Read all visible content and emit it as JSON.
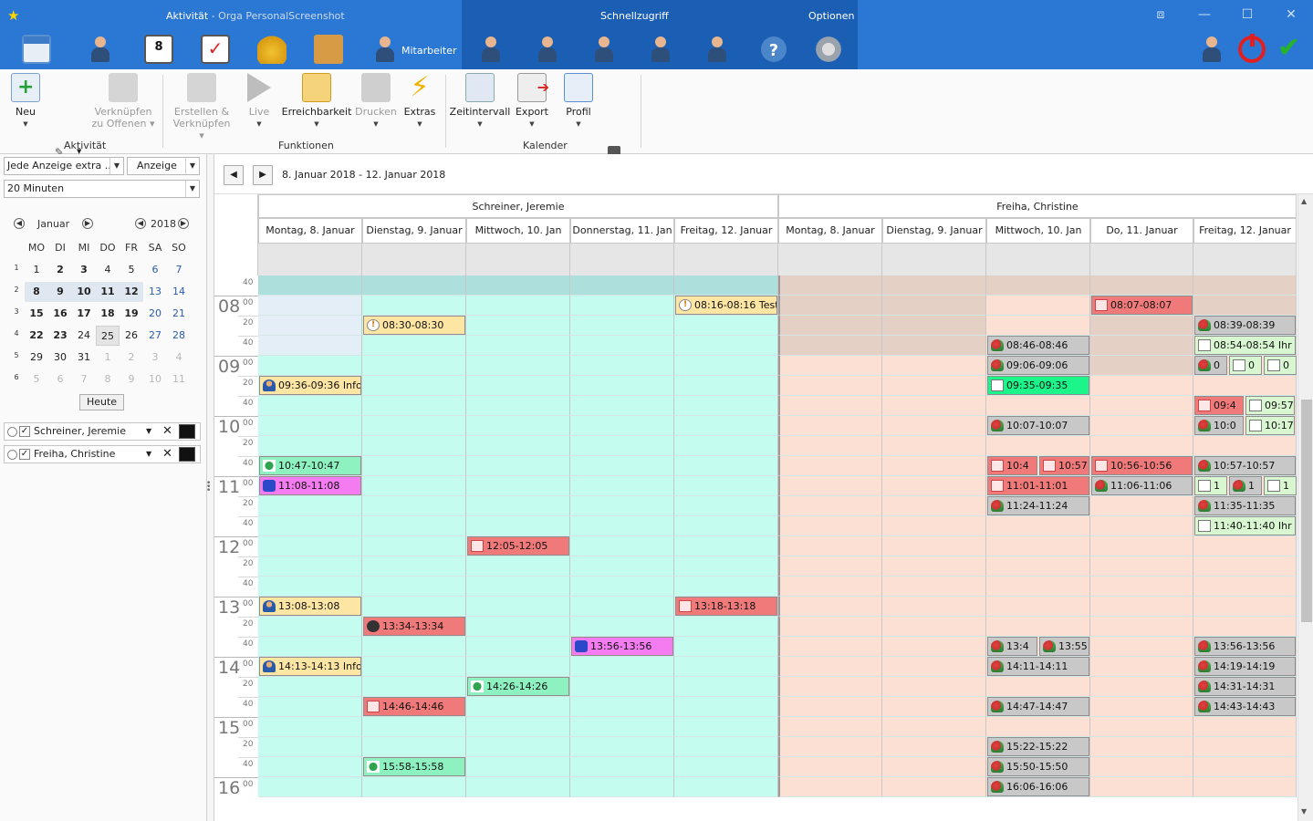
{
  "window": {
    "title_active": "Aktivität",
    "title_app": "Orga PersonalScreenshot",
    "quick_access": "Schnellzugriff",
    "options": "Optionen"
  },
  "toolbar": {
    "mitarbeiter_label": "Mitarbeiter"
  },
  "ribbon": {
    "groups": {
      "aktivitaet": "Aktivität",
      "funktionen": "Funktionen",
      "kalender": "Kalender"
    },
    "buttons": {
      "neu": "Neu",
      "verknuepfen_1": "Verknüpfen",
      "verknuepfen_2": "zu Offenen",
      "erstellen_1": "Erstellen &",
      "erstellen_2": "Verknüpfen",
      "live": "Live",
      "erreichbarkeit": "Erreichbarkeit",
      "drucken": "Drucken",
      "extras": "Extras",
      "zeitintervall": "Zeitintervall",
      "export": "Export",
      "profil": "Profil"
    }
  },
  "left": {
    "view_combo": "Jede Anzeige extra ...",
    "anzeige_combo": "Anzeige",
    "interval_combo": "20 Minuten",
    "month": "Januar",
    "year": "2018",
    "dow": [
      "MO",
      "DI",
      "MI",
      "DO",
      "FR",
      "SA",
      "SO"
    ],
    "weeks": [
      "1",
      "2",
      "3",
      "4",
      "5",
      "6"
    ],
    "days": [
      [
        "1",
        "2",
        "3",
        "4",
        "5",
        "6",
        "7"
      ],
      [
        "8",
        "9",
        "10",
        "11",
        "12",
        "13",
        "14"
      ],
      [
        "15",
        "16",
        "17",
        "18",
        "19",
        "20",
        "21"
      ],
      [
        "22",
        "23",
        "24",
        "25",
        "26",
        "27",
        "28"
      ],
      [
        "29",
        "30",
        "31",
        "1",
        "2",
        "3",
        "4"
      ],
      [
        "5",
        "6",
        "7",
        "8",
        "9",
        "10",
        "11"
      ]
    ],
    "today_button": "Heute",
    "resources": [
      "Schreiner, Jeremie",
      "Freiha, Christine"
    ]
  },
  "scheduler": {
    "date_range": "8. Januar 2018 - 12. Januar 2018",
    "resources": [
      "Schreiner, Jeremie",
      "Freiha, Christine"
    ],
    "days_jeremie": [
      "Montag, 8. Januar",
      "Dienstag, 9. Januar",
      "Mittwoch, 10. Jan",
      "Donnerstag, 11. Jan",
      "Freitag, 12. Januar"
    ],
    "days_christine": [
      "Montag, 8. Januar",
      "Dienstag, 9. Januar",
      "Mittwoch, 10. Jan",
      "Do, 11. Januar",
      "Freitag, 12. Januar"
    ],
    "hours": [
      "08",
      "09",
      "10",
      "11",
      "12",
      "13",
      "14",
      "15",
      "16"
    ],
    "minute_labels": [
      "00",
      "20",
      "40"
    ],
    "top_minute": "40"
  },
  "events": [
    {
      "col": 4,
      "slot": 1,
      "text": "08:16-08:16 Test",
      "kind": "yellow",
      "icon": "warn"
    },
    {
      "col": 1,
      "slot": 2,
      "text": "08:30-08:30",
      "kind": "yellow",
      "icon": "warn"
    },
    {
      "col": 0,
      "slot": 5,
      "text": "09:36-09:36 Info",
      "kind": "yellow",
      "icon": "user"
    },
    {
      "col": 0,
      "slot": 9,
      "text": "10:47-10:47",
      "kind": "green",
      "icon": "green"
    },
    {
      "col": 0,
      "slot": 10,
      "text": "11:08-11:08",
      "kind": "magenta",
      "icon": "run"
    },
    {
      "col": 2,
      "slot": 13,
      "text": "12:05-12:05",
      "kind": "red",
      "icon": "medic"
    },
    {
      "col": 0,
      "slot": 16,
      "text": "13:08-13:08",
      "kind": "yellow",
      "icon": "user"
    },
    {
      "col": 4,
      "slot": 16,
      "text": "13:18-13:18",
      "kind": "red",
      "icon": "medic"
    },
    {
      "col": 1,
      "slot": 17,
      "text": "13:34-13:34",
      "kind": "red",
      "icon": "lock"
    },
    {
      "col": 3,
      "slot": 18,
      "text": "13:56-13:56",
      "kind": "magenta",
      "icon": "run"
    },
    {
      "col": 0,
      "slot": 19,
      "text": "14:13-14:13 Info",
      "kind": "yellow",
      "icon": "user"
    },
    {
      "col": 2,
      "slot": 20,
      "text": "14:26-14:26",
      "kind": "green",
      "icon": "green"
    },
    {
      "col": 1,
      "slot": 21,
      "text": "14:46-14:46",
      "kind": "red",
      "icon": "medic"
    },
    {
      "col": 1,
      "slot": 24,
      "text": "15:58-15:58",
      "kind": "green",
      "icon": "green"
    },
    {
      "col": 8,
      "slot": 1,
      "text": "08:07-08:07",
      "kind": "red",
      "icon": "medic"
    },
    {
      "col": 9,
      "slot": 2,
      "text": "08:39-08:39",
      "kind": "gray",
      "icon": "phone"
    },
    {
      "col": 7,
      "slot": 3,
      "text": "08:46-08:46",
      "kind": "gray",
      "icon": "phone"
    },
    {
      "col": 9,
      "slot": 3,
      "text": "08:54-08:54 Ihr",
      "kind": "lightgreen",
      "icon": "doc"
    },
    {
      "col": 7,
      "slot": 4,
      "text": "09:06-09:06",
      "kind": "gray",
      "icon": "phone"
    },
    {
      "col": 9,
      "slot": 4,
      "sub": 0,
      "text": "0",
      "kind": "gray",
      "icon": "phone"
    },
    {
      "col": 9,
      "slot": 4,
      "sub": 1,
      "text": "0",
      "kind": "lightgreen",
      "icon": "doc"
    },
    {
      "col": 9,
      "slot": 4,
      "sub": 2,
      "text": "0",
      "kind": "lightgreen",
      "icon": "doc"
    },
    {
      "col": 7,
      "slot": 5,
      "text": "09:35-09:35",
      "kind": "bright",
      "icon": "doc"
    },
    {
      "col": 9,
      "slot": 6,
      "sub": 0,
      "half": true,
      "text": "09:4",
      "kind": "red",
      "icon": "medic"
    },
    {
      "col": 9,
      "slot": 6,
      "sub": 1,
      "half": true,
      "text": "09:57",
      "kind": "lightgreen",
      "icon": "doc"
    },
    {
      "col": 7,
      "slot": 7,
      "text": "10:07-10:07",
      "kind": "gray",
      "icon": "phone"
    },
    {
      "col": 9,
      "slot": 7,
      "sub": 0,
      "half": true,
      "text": "10:0",
      "kind": "gray",
      "icon": "phone"
    },
    {
      "col": 9,
      "slot": 7,
      "sub": 1,
      "half": true,
      "text": "10:17",
      "kind": "lightgreen",
      "icon": "doc"
    },
    {
      "col": 7,
      "slot": 9,
      "sub": 0,
      "half": true,
      "text": "10:4",
      "kind": "red",
      "icon": "medic"
    },
    {
      "col": 7,
      "slot": 9,
      "sub": 1,
      "half": true,
      "text": "10:57",
      "kind": "red",
      "icon": "medic"
    },
    {
      "col": 8,
      "slot": 9,
      "text": "10:56-10:56",
      "kind": "red",
      "icon": "medic"
    },
    {
      "col": 9,
      "slot": 9,
      "text": "10:57-10:57",
      "kind": "gray",
      "icon": "phone"
    },
    {
      "col": 7,
      "slot": 10,
      "text": "11:01-11:01",
      "kind": "red",
      "icon": "medic"
    },
    {
      "col": 8,
      "slot": 10,
      "text": "11:06-11:06",
      "kind": "gray",
      "icon": "phone"
    },
    {
      "col": 9,
      "slot": 10,
      "sub": 0,
      "text": "1",
      "kind": "lightgreen",
      "icon": "doc"
    },
    {
      "col": 9,
      "slot": 10,
      "sub": 1,
      "text": "1",
      "kind": "gray",
      "icon": "phone"
    },
    {
      "col": 9,
      "slot": 10,
      "sub": 2,
      "text": "1",
      "kind": "lightgreen",
      "icon": "doc"
    },
    {
      "col": 7,
      "slot": 11,
      "text": "11:24-11:24",
      "kind": "gray",
      "icon": "phone"
    },
    {
      "col": 9,
      "slot": 11,
      "text": "11:35-11:35",
      "kind": "gray",
      "icon": "phone"
    },
    {
      "col": 9,
      "slot": 12,
      "text": "11:40-11:40 Ihr",
      "kind": "lightgreen",
      "icon": "doc"
    },
    {
      "col": 7,
      "slot": 18,
      "sub": 0,
      "half": true,
      "text": "13:4",
      "kind": "gray",
      "icon": "phone"
    },
    {
      "col": 7,
      "slot": 18,
      "sub": 1,
      "half": true,
      "text": "13:55",
      "kind": "gray",
      "icon": "phone"
    },
    {
      "col": 9,
      "slot": 18,
      "text": "13:56-13:56",
      "kind": "gray",
      "icon": "phone"
    },
    {
      "col": 7,
      "slot": 19,
      "text": "14:11-14:11",
      "kind": "gray",
      "icon": "phone"
    },
    {
      "col": 9,
      "slot": 19,
      "text": "14:19-14:19",
      "kind": "gray",
      "icon": "phone"
    },
    {
      "col": 9,
      "slot": 20,
      "text": "14:31-14:31",
      "kind": "gray",
      "icon": "phone"
    },
    {
      "col": 7,
      "slot": 21,
      "text": "14:47-14:47",
      "kind": "gray",
      "icon": "phone"
    },
    {
      "col": 9,
      "slot": 21,
      "text": "14:43-14:43",
      "kind": "gray",
      "icon": "phone"
    },
    {
      "col": 7,
      "slot": 23,
      "text": "15:22-15:22",
      "kind": "gray",
      "icon": "phone"
    },
    {
      "col": 7,
      "slot": 24,
      "text": "15:50-15:50",
      "kind": "gray",
      "icon": "phone"
    },
    {
      "col": 7,
      "slot": 25,
      "text": "16:06-16:06",
      "kind": "gray",
      "icon": "phone"
    }
  ],
  "colors": {
    "title_bar": "#2b78d4",
    "quick_access_panel": "#1b5fb5",
    "jeremie_work": "#c4fcf0",
    "jeremie_top": "#ade0dc",
    "jeremie_offhours": "#e4eef6",
    "christine_work": "#fce0d4",
    "christine_offhours": "#e4d0c4",
    "evt_yellow": "#fde6a4",
    "evt_red": "#f07a7a",
    "evt_green": "#8ef2c0",
    "evt_magenta": "#f47cf0",
    "evt_gray": "#c8c8c8",
    "evt_lightgreen": "#d8f7d0",
    "evt_bright": "#1cf58a"
  }
}
